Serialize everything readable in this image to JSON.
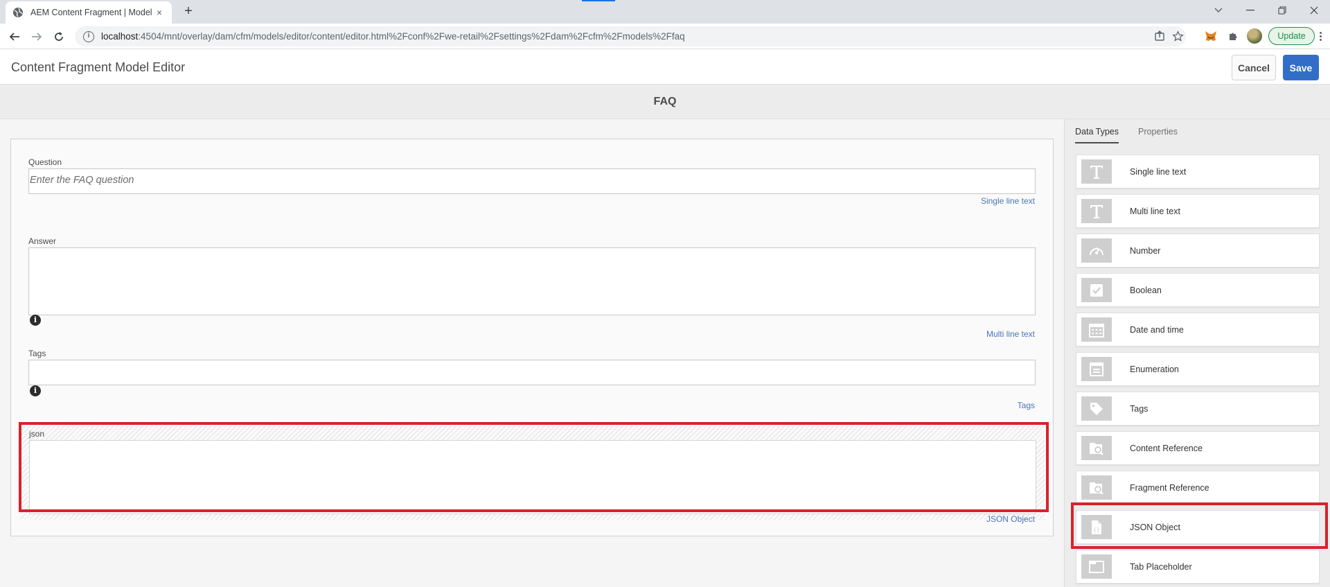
{
  "browser": {
    "tab_title": "AEM Content Fragment | Model",
    "tab_close_glyph": "×",
    "new_tab_glyph": "+",
    "url_host": "localhost",
    "url_path": ":4504/mnt/overlay/dam/cfm/models/editor/content/editor.html%2Fconf%2Fwe-retail%2Fsettings%2Fdam%2Fcfm%2Fmodels%2Ffaq",
    "update_label": "Update"
  },
  "app": {
    "title": "Content Fragment Model Editor",
    "cancel_label": "Cancel",
    "save_label": "Save",
    "model_name": "FAQ"
  },
  "form": {
    "question": {
      "label": "Question",
      "placeholder": "Enter the FAQ question",
      "type": "Single line text"
    },
    "answer": {
      "label": "Answer",
      "type": "Multi line text"
    },
    "tags": {
      "label": "Tags",
      "type": "Tags"
    },
    "json": {
      "label": "json",
      "type": "JSON Object"
    },
    "info_glyph": "i"
  },
  "sidebar": {
    "tabs": [
      {
        "label": "Data Types",
        "active": true
      },
      {
        "label": "Properties",
        "active": false
      }
    ],
    "data_types": [
      {
        "label": "Single line text",
        "icon": "text-icon"
      },
      {
        "label": "Multi line text",
        "icon": "text-icon"
      },
      {
        "label": "Number",
        "icon": "gauge-icon"
      },
      {
        "label": "Boolean",
        "icon": "checkbox-icon"
      },
      {
        "label": "Date and time",
        "icon": "calendar-icon"
      },
      {
        "label": "Enumeration",
        "icon": "list-icon"
      },
      {
        "label": "Tags",
        "icon": "tag-icon"
      },
      {
        "label": "Content Reference",
        "icon": "folder-search-icon"
      },
      {
        "label": "Fragment Reference",
        "icon": "folder-search-icon"
      },
      {
        "label": "JSON Object",
        "icon": "json-file-icon"
      },
      {
        "label": "Tab Placeholder",
        "icon": "tab-icon"
      }
    ]
  },
  "colors": {
    "accent": "#326ec8",
    "highlight": "#d9222a",
    "link": "#4a74b8"
  }
}
